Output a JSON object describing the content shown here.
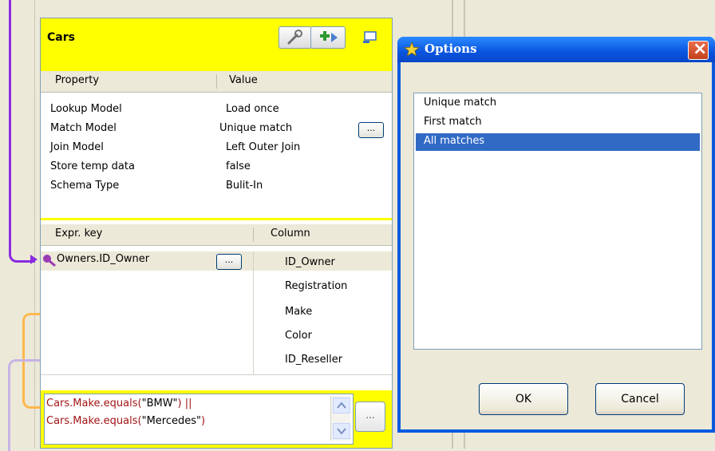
{
  "lookup_table": {
    "title": "Cars",
    "toolbar": {
      "settings_icon": "wrench-icon",
      "add_icon": "add-column-icon",
      "minimize_icon": "minimize-icon"
    },
    "properties": {
      "headers": {
        "property": "Property",
        "value": "Value"
      },
      "rows": [
        {
          "property": "Lookup Model",
          "value": "Load once"
        },
        {
          "property": "Match Model",
          "value": "Unique match"
        },
        {
          "property": "Join Model",
          "value": "Left Outer Join"
        },
        {
          "property": "Store temp data",
          "value": "false"
        },
        {
          "property": "Schema Type",
          "value": "Bulit-In"
        }
      ],
      "browse_label": "..."
    },
    "schema": {
      "headers": {
        "expr_key": "Expr. key",
        "column": "Column"
      },
      "expr_key_value": "Owners.ID_Owner",
      "browse_label": "...",
      "columns": [
        "ID_Owner",
        "Registration",
        "Make",
        "Color",
        "ID_Reseller"
      ]
    },
    "filter": {
      "line1_code": "Cars.Make.equals(",
      "line1_string": "\"BMW\"",
      "line1_tail": ") ||",
      "line2_code": "Cars.Make.equals(",
      "line2_string": "\"Mercedes\"",
      "line2_tail": ")",
      "browse_label": "..."
    }
  },
  "options_dialog": {
    "title": "Options",
    "items": [
      {
        "label": "Unique match",
        "selected": false
      },
      {
        "label": "First match",
        "selected": false
      },
      {
        "label": "All matches",
        "selected": true
      }
    ],
    "ok_label": "OK",
    "cancel_label": "Cancel",
    "close_label": "×"
  },
  "colors": {
    "header_yellow": "#ffff00",
    "selection_blue": "#316ac5",
    "xp_title_blue": "#0a54df",
    "code_red": "#a31515"
  }
}
